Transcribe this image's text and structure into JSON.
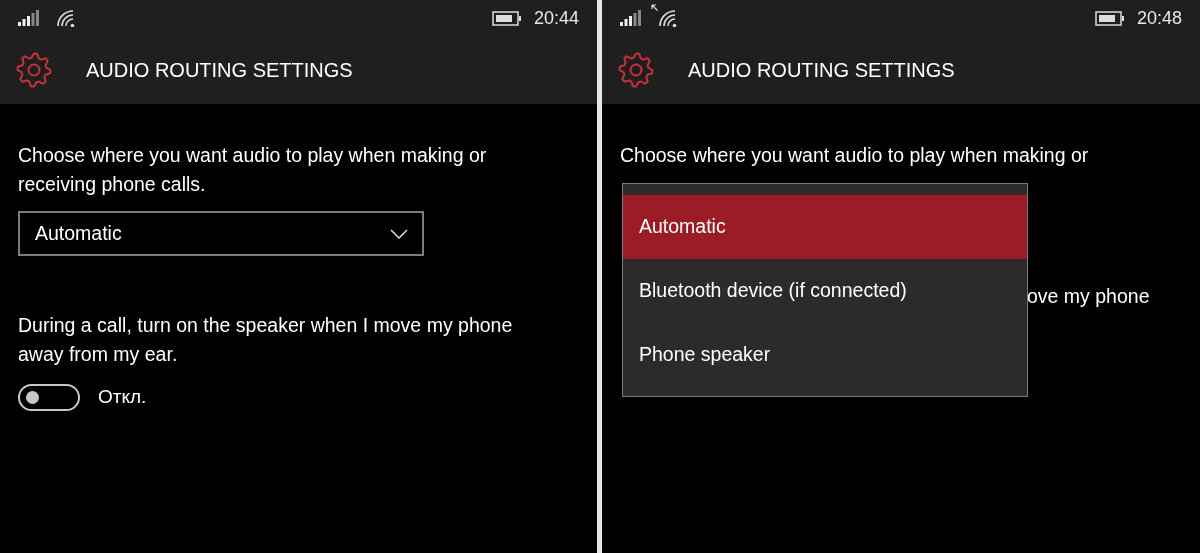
{
  "screens": [
    {
      "status_bar": {
        "data_activity": false,
        "time": "20:44"
      },
      "header": {
        "title": "AUDIO ROUTING SETTINGS"
      },
      "intro_text": "Choose where you want audio to play when making or receiving phone calls.",
      "route_select": {
        "value": "Automatic"
      },
      "speaker_text": "During a call, turn on the speaker when I move my phone away from my ear.",
      "speaker_toggle": {
        "on": false,
        "label": "Откл."
      }
    },
    {
      "status_bar": {
        "data_activity": true,
        "time": "20:48"
      },
      "header": {
        "title": "AUDIO ROUTING SETTINGS"
      },
      "intro_text": "Choose where you want audio to play when making or",
      "route_popup": {
        "options": [
          {
            "label": "Automatic",
            "selected": true
          },
          {
            "label": "Bluetooth device (if connected)",
            "selected": false
          },
          {
            "label": "Phone speaker",
            "selected": false
          }
        ]
      },
      "speaker_text_fragment": "ove my phone"
    }
  ]
}
